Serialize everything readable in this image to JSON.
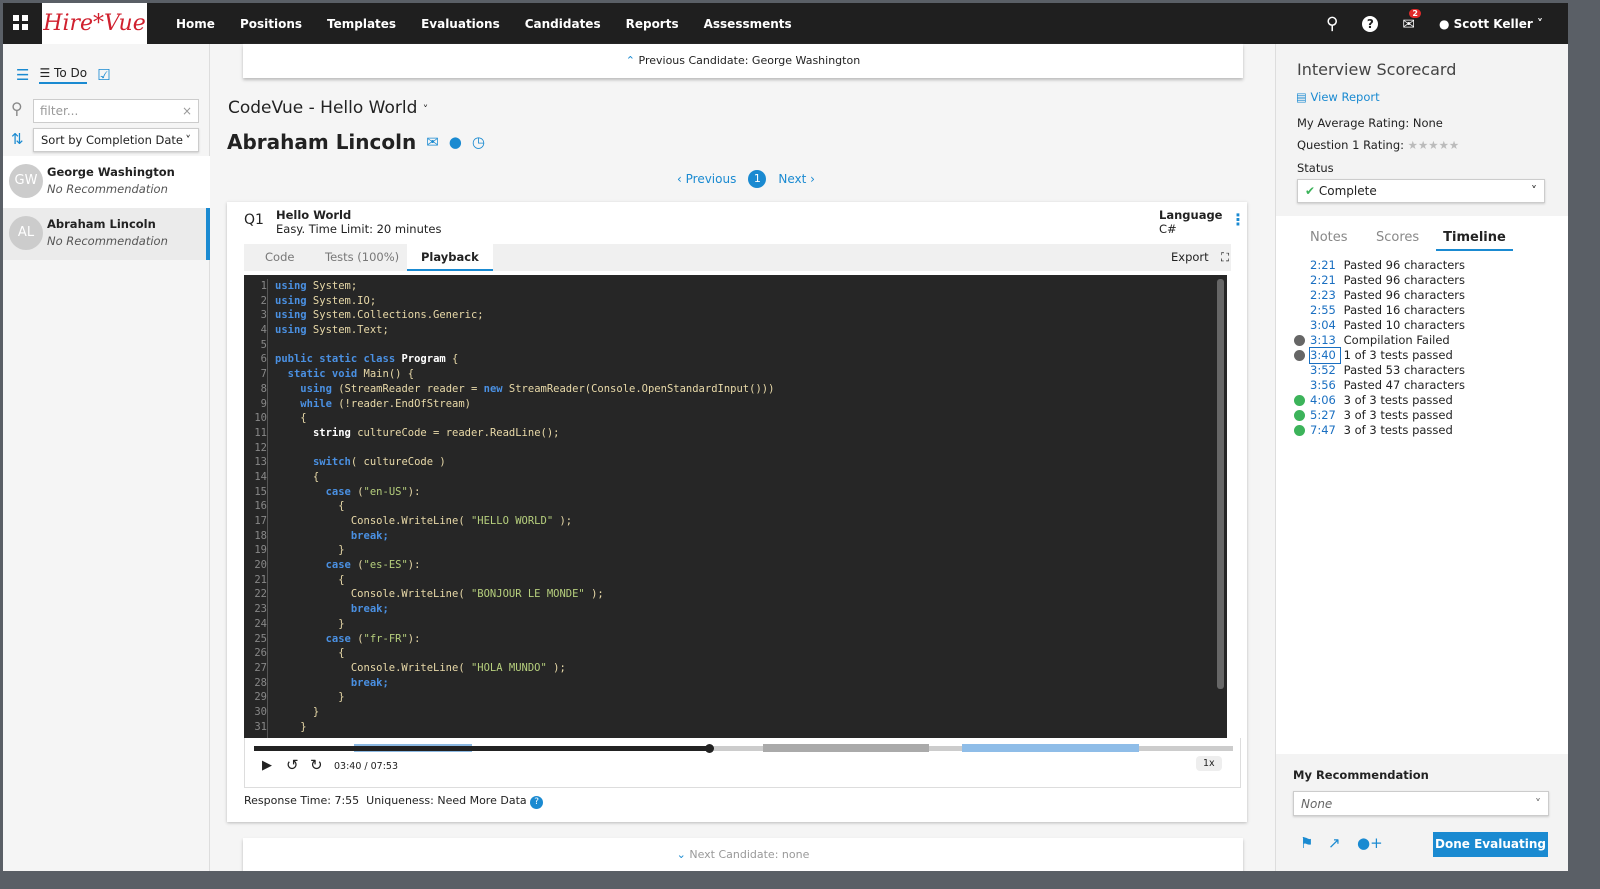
{
  "nav": {
    "logo": "HireVue",
    "items": [
      "Home",
      "Positions",
      "Templates",
      "Evaluations",
      "Candidates",
      "Reports",
      "Assessments"
    ],
    "notifications": "2",
    "user": "Scott Keller"
  },
  "sidebar": {
    "view_label": "To Do",
    "filter_placeholder": "filter...",
    "sort": "Sort by Completion Date",
    "candidates": [
      {
        "initials": "GW",
        "name": "George Washington",
        "rec": "No Recommendation"
      },
      {
        "initials": "AL",
        "name": "Abraham Lincoln",
        "rec": "No Recommendation",
        "selected": true
      }
    ]
  },
  "main": {
    "previous": "Previous Candidate: George Washington",
    "next": "Next Candidate: none",
    "interview": "CodeVue - Hello World",
    "candidate": "Abraham Lincoln",
    "pager": {
      "prev": "Previous",
      "page": "1",
      "next": "Next"
    },
    "question": {
      "number": "Q1",
      "title": "Hello World",
      "meta": "Easy. Time Limit: 20 minutes",
      "language_label": "Language",
      "language": "C#"
    },
    "tabs": [
      "Code",
      "Tests (100%)",
      "Playback"
    ],
    "active_tab": "Playback",
    "export": "Export",
    "code": [
      "using System;",
      "using System.IO;",
      "using System.Collections.Generic;",
      "using System.Text;",
      "",
      "public static class Program {",
      "  static void Main() {",
      "    using (StreamReader reader = new StreamReader(Console.OpenStandardInput()))",
      "    while (!reader.EndOfStream)",
      "    {",
      "      string cultureCode = reader.ReadLine();",
      "",
      "      switch( cultureCode )",
      "      {",
      "        case (\"en-US\"):",
      "          {",
      "            Console.WriteLine( \"HELLO WORLD\" );",
      "            break;",
      "          }",
      "        case (\"es-ES\"):",
      "          {",
      "            Console.WriteLine( \"BONJOUR LE MONDE\" );",
      "            break;",
      "          }",
      "        case (\"fr-FR\"):",
      "          {",
      "            Console.WriteLine( \"HOLA MUNDO\" );",
      "            break;",
      "          }",
      "      }",
      "    }"
    ],
    "player": {
      "time": "03:40 / 07:53",
      "progress_fraction": 0.465,
      "speed": "1x"
    },
    "footer": "Response Time: 7:55  Uniqueness: Need More Data"
  },
  "scorecard": {
    "title": "Interview Scorecard",
    "view_report": "View Report",
    "avg_rating": "My Average Rating: None",
    "q_rating": "Question 1 Rating:",
    "stars": 0,
    "status_label": "Status",
    "status": "Complete",
    "tabs": [
      "Notes",
      "Scores",
      "Timeline"
    ],
    "active_tab": "Timeline",
    "timeline": [
      {
        "t": "2:21",
        "e": "Pasted 96 characters",
        "dot": ""
      },
      {
        "t": "2:21",
        "e": "Pasted 96 characters",
        "dot": ""
      },
      {
        "t": "2:23",
        "e": "Pasted 96 characters",
        "dot": ""
      },
      {
        "t": "2:55",
        "e": "Pasted 16 characters",
        "dot": ""
      },
      {
        "t": "3:04",
        "e": "Pasted 10 characters",
        "dot": ""
      },
      {
        "t": "3:13",
        "e": "Compilation Failed",
        "dot": "#666666"
      },
      {
        "t": "3:40",
        "e": "1 of 3 tests passed",
        "dot": "#666666"
      },
      {
        "t": "3:52",
        "e": "Pasted 53 characters",
        "dot": ""
      },
      {
        "t": "3:56",
        "e": "Pasted 47 characters",
        "dot": ""
      },
      {
        "t": "4:06",
        "e": "3 of 3 tests passed",
        "dot": "#3cb35a"
      },
      {
        "t": "5:27",
        "e": "3 of 3 tests passed",
        "dot": "#3cb35a"
      },
      {
        "t": "7:47",
        "e": "3 of 3 tests passed",
        "dot": "#3cb35a"
      }
    ],
    "rec_label": "My Recommendation",
    "rec_value": "None",
    "done": "Done Evaluating"
  },
  "colors": {
    "accent": "#1a8ad1",
    "nav": "#1f1f1f",
    "brand": "#d0202e"
  }
}
